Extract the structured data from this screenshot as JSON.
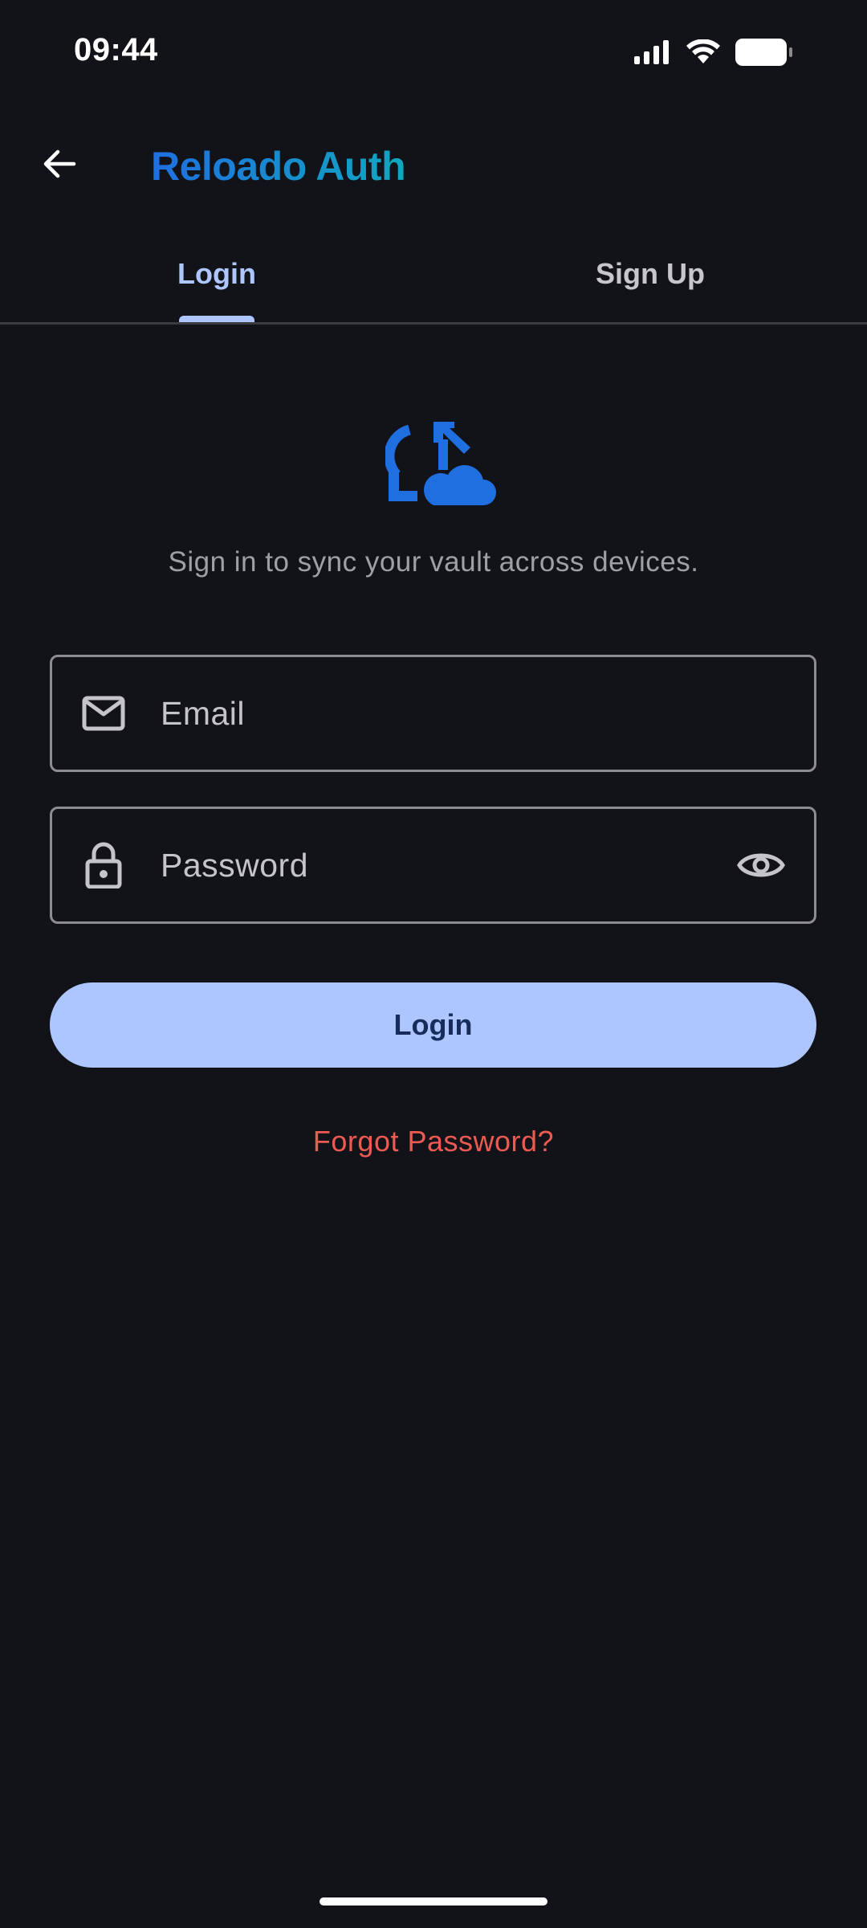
{
  "status_bar": {
    "time": "09:44",
    "icons": [
      "signal-icon",
      "wifi-icon",
      "battery-icon"
    ]
  },
  "app_bar": {
    "back_icon": "arrow-left-icon",
    "title": "Reloado Auth"
  },
  "tabs": [
    {
      "label": "Login",
      "active": true
    },
    {
      "label": "Sign Up",
      "active": false
    }
  ],
  "hero": {
    "icon": "cloud-sync-icon",
    "subtitle": "Sign in to sync your vault across devices."
  },
  "form": {
    "email": {
      "placeholder": "Email",
      "value": "",
      "icon": "mail-icon"
    },
    "password": {
      "placeholder": "Password",
      "value": "",
      "icon": "lock-icon",
      "toggle_icon": "eye-icon"
    },
    "submit_label": "Login",
    "forgot_label": "Forgot Password?"
  },
  "colors": {
    "background": "#121318",
    "accent": "#aec6ff",
    "brand_gradient_start": "#1f6fe0",
    "brand_gradient_end": "#10a7c0",
    "danger": "#ec5a52"
  }
}
